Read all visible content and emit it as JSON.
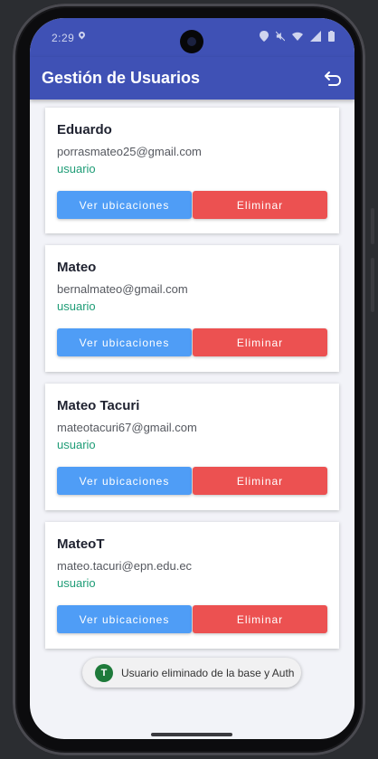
{
  "status_bar": {
    "time": "2:29"
  },
  "app_bar": {
    "title": "Gestión de Usuarios"
  },
  "users": [
    {
      "name": "Eduardo",
      "email": "porrasmateo25@gmail.com",
      "role": "usuario"
    },
    {
      "name": "Mateo",
      "email": "bernalmateo@gmail.com",
      "role": "usuario"
    },
    {
      "name": "Mateo Tacuri",
      "email": "mateotacuri67@gmail.com",
      "role": "usuario"
    },
    {
      "name": "MateoT",
      "email": "mateo.tacuri@epn.edu.ec",
      "role": "usuario"
    }
  ],
  "buttons": {
    "view_locations": "Ver ubicaciones",
    "delete": "Eliminar"
  },
  "toast": {
    "icon_letter": "T",
    "message": "Usuario eliminado de la base y Auth"
  },
  "colors": {
    "primary": "#3f51b5",
    "view_button": "#4f9df6",
    "delete_button": "#ec5151",
    "role_text": "#1e9c76"
  },
  "icons": {
    "back": "undo-arrow-icon"
  }
}
